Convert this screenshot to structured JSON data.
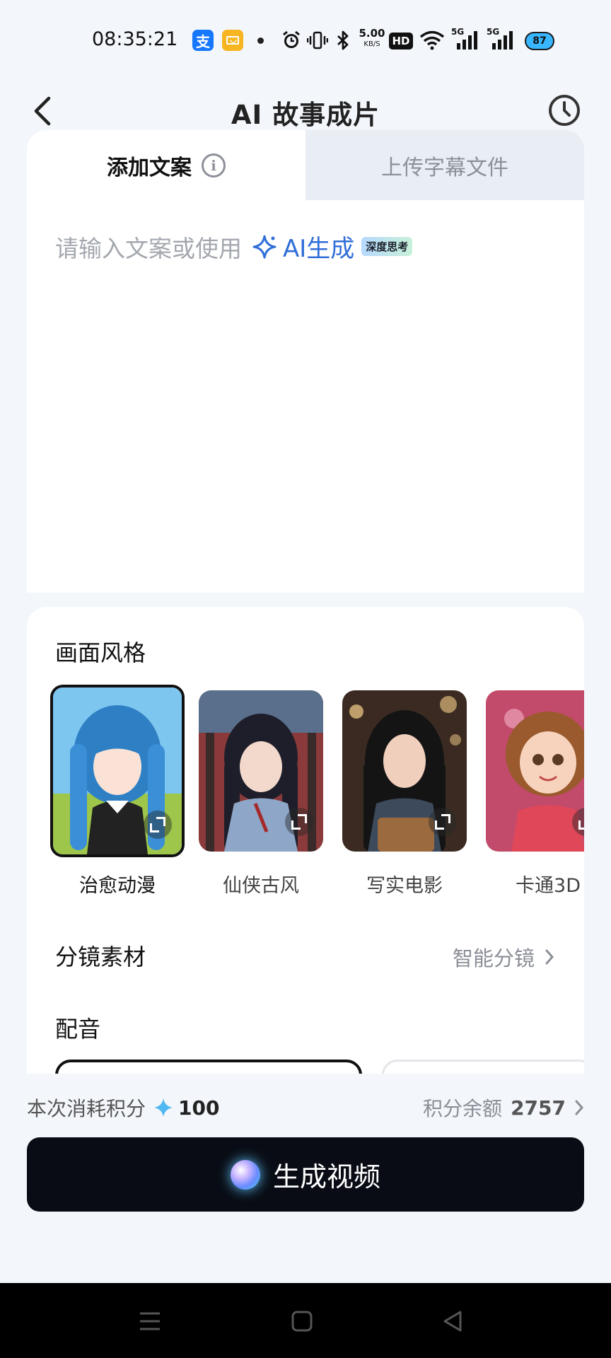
{
  "status_bar": {
    "time": "08:35:21",
    "alipay_icon_text": "支",
    "speed_value": "5.00",
    "speed_unit": "KB/S",
    "hd_label": "HD",
    "signal_label_1": "5G",
    "signal_label_2": "5G",
    "battery": "87",
    "icons": [
      "alipay-icon",
      "mail-icon",
      "notification-dot-icon",
      "alarm-icon",
      "vibrate-icon",
      "bluetooth-icon",
      "hd-icon",
      "wifi-icon",
      "signal-5g-icon",
      "signal-5g-icon",
      "battery-icon"
    ]
  },
  "header": {
    "title": "AI 故事成片",
    "back_icon": "chevron-left-icon",
    "history_icon": "clock-history-icon"
  },
  "editor": {
    "tabs": [
      {
        "label": "添加文案",
        "active": true
      },
      {
        "label": "上传字幕文件",
        "active": false
      }
    ],
    "info_icon_text": "i",
    "placeholder": "请输入文案或使用",
    "ai_generate_label": "AI生成",
    "deep_think_badge": "深度思考"
  },
  "settings": {
    "style_section_title": "画面风格",
    "styles": [
      {
        "label": "治愈动漫",
        "selected": true
      },
      {
        "label": "仙侠古风",
        "selected": false
      },
      {
        "label": "写实电影",
        "selected": false
      },
      {
        "label": "卡通3D",
        "selected": false
      }
    ],
    "storyboard_title": "分镜素材",
    "storyboard_value": "智能分镜",
    "voice_title": "配音"
  },
  "footer": {
    "cost_label": "本次消耗积分",
    "cost_value": "100",
    "balance_label": "积分余额",
    "balance_value": "2757",
    "generate_label": "生成视频"
  },
  "colors": {
    "background": "#f3f6fb",
    "accent_blue": "#2f6ed8",
    "button_dark": "#090c14",
    "inactive_tab": "#e9edf4"
  }
}
